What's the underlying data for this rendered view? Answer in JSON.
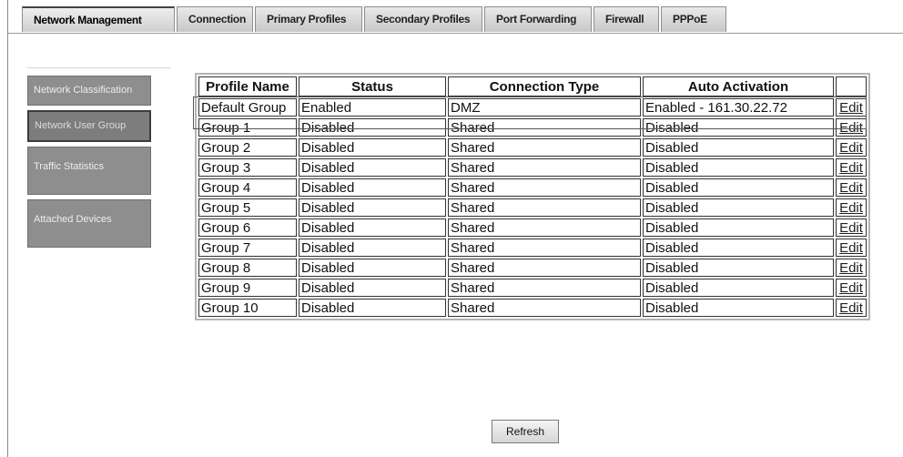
{
  "tabs": [
    {
      "label": "Network Management"
    },
    {
      "label": "Connection"
    },
    {
      "label": "Primary Profiles"
    },
    {
      "label": "Secondary Profiles"
    },
    {
      "label": "Port Forwarding"
    },
    {
      "label": "Firewall"
    },
    {
      "label": "PPPoE"
    }
  ],
  "sidenav": {
    "items": [
      {
        "label": "Network Classification"
      },
      {
        "label": "Network User Group",
        "selected": true
      },
      {
        "label": "Traffic Statistics"
      },
      {
        "label": "Attached Devices"
      }
    ]
  },
  "table": {
    "headers": [
      "Profile Name",
      "Status",
      "Connection Type",
      "Auto Activation",
      ""
    ],
    "rows": [
      {
        "name": "Default Group",
        "status": "Enabled",
        "type": "DMZ",
        "auto": "Enabled -  161.30.22.72",
        "edit": "Edit"
      },
      {
        "name": "Group 1",
        "status": "Disabled",
        "type": "Shared",
        "auto": "Disabled",
        "edit": "Edit"
      },
      {
        "name": "Group 2",
        "status": "Disabled",
        "type": "Shared",
        "auto": "Disabled",
        "edit": "Edit"
      },
      {
        "name": "Group 3",
        "status": "Disabled",
        "type": "Shared",
        "auto": "Disabled",
        "edit": "Edit"
      },
      {
        "name": "Group 4",
        "status": "Disabled",
        "type": "Shared",
        "auto": "Disabled",
        "edit": "Edit"
      },
      {
        "name": "Group 5",
        "status": "Disabled",
        "type": "Shared",
        "auto": "Disabled",
        "edit": "Edit"
      },
      {
        "name": "Group 6",
        "status": "Disabled",
        "type": "Shared",
        "auto": "Disabled",
        "edit": "Edit"
      },
      {
        "name": "Group 7",
        "status": "Disabled",
        "type": "Shared",
        "auto": "Disabled",
        "edit": "Edit"
      },
      {
        "name": "Group 8",
        "status": "Disabled",
        "type": "Shared",
        "auto": "Disabled",
        "edit": "Edit"
      },
      {
        "name": "Group 9",
        "status": "Disabled",
        "type": "Shared",
        "auto": "Disabled",
        "edit": "Edit"
      },
      {
        "name": "Group 10",
        "status": "Disabled",
        "type": "Shared",
        "auto": "Disabled",
        "edit": "Edit"
      }
    ]
  },
  "refresh_label": "Refresh"
}
